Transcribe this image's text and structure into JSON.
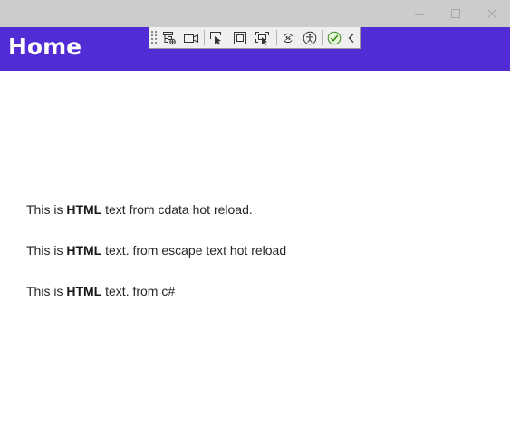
{
  "window": {
    "minimize_icon": "minimize-icon",
    "maximize_icon": "maximize-icon",
    "close_icon": "close-icon"
  },
  "header": {
    "title": "Home",
    "background": "#512bd4"
  },
  "dev_toolbar": {
    "buttons": [
      "live-visual-tree-icon",
      "video-camera-icon",
      "select-element-icon",
      "display-layout-adorners-icon",
      "track-focused-element-icon",
      "hot-reload-icon",
      "accessibility-icon",
      "checkmark-icon",
      "collapse-chevron-icon"
    ]
  },
  "content": {
    "lines": [
      {
        "prefix": "This is ",
        "bold": "HTML",
        "suffix": " text from cdata hot reload."
      },
      {
        "prefix": "This is ",
        "bold": "HTML",
        "suffix": " text. from escape text hot reload"
      },
      {
        "prefix": "This is ",
        "bold": "HTML",
        "suffix": " text. from c#"
      }
    ]
  }
}
